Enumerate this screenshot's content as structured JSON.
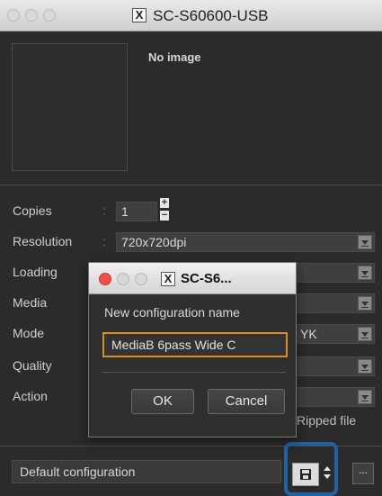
{
  "window": {
    "title": "SC-S60600-USB"
  },
  "preview": {
    "no_image": "No image"
  },
  "fields": {
    "copies_label": "Copies",
    "copies_value": "1",
    "resolution_label": "Resolution",
    "resolution_value": "720x720dpi",
    "loading_label": "Loading",
    "media_label": "Media",
    "mode_label": "Mode",
    "mode_value_partial": "YK",
    "quality_label": "Quality",
    "action_label": "Action",
    "ripped_file_label": "Ripped file"
  },
  "footer": {
    "configuration_value": "Default configuration",
    "more_label": "..."
  },
  "dialog": {
    "title": "SC-S6...",
    "prompt": "New configuration name",
    "input_value": "MediaB 6pass Wide C",
    "ok_label": "OK",
    "cancel_label": "Cancel"
  },
  "colors": {
    "highlight": "#1f62a7",
    "input_focus": "#d98e25"
  },
  "icons": {
    "save": "floppy-disk-icon",
    "close": "close-icon"
  }
}
